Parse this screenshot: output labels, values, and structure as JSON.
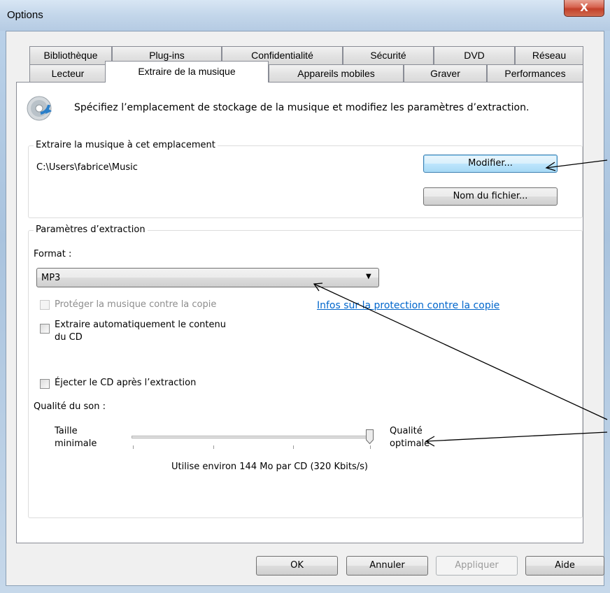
{
  "window": {
    "title": "Options",
    "close_glyph": "X"
  },
  "tabs": {
    "row1": [
      "Bibliothèque",
      "Plug-ins",
      "Confidentialité",
      "Sécurité",
      "DVD",
      "Réseau"
    ],
    "row2": [
      "Lecteur",
      "Extraire de la musique",
      "Appareils mobiles",
      "Graver",
      "Performances"
    ],
    "active": "Extraire de la musique"
  },
  "header": {
    "icon": "cd-rip-icon",
    "description": "Spécifiez l’emplacement de stockage de la musique et modifiez les paramètres d’extraction."
  },
  "location": {
    "group_title": "Extraire la musique à cet emplacement",
    "path": "C:\\Users\\fabrice\\Music",
    "change_button": "Modifier...",
    "filename_button": "Nom du fichier..."
  },
  "settings": {
    "group_title": "Paramètres d’extraction",
    "format_label": "Format :",
    "format_value": "MP3",
    "copy_protect_label": "Protéger la musique contre la copie",
    "copy_protect_link": "Infos sur la protection contre la copie",
    "auto_rip_line1": "Extraire automatiquement le contenu",
    "auto_rip_line2": "du CD",
    "eject_label": "Éjecter le CD après l’extraction",
    "quality_label": "Qualité du son :",
    "min_label_line1": "Taille",
    "min_label_line2": "minimale",
    "max_label_line1": "Qualité",
    "max_label_line2": "optimale",
    "quality_level_fraction": 1.0,
    "usage_text": "Utilise environ 144 Mo par CD (320 Kbits/s)"
  },
  "footer": {
    "ok": "OK",
    "cancel": "Annuler",
    "apply": "Appliquer",
    "help": "Aide"
  }
}
